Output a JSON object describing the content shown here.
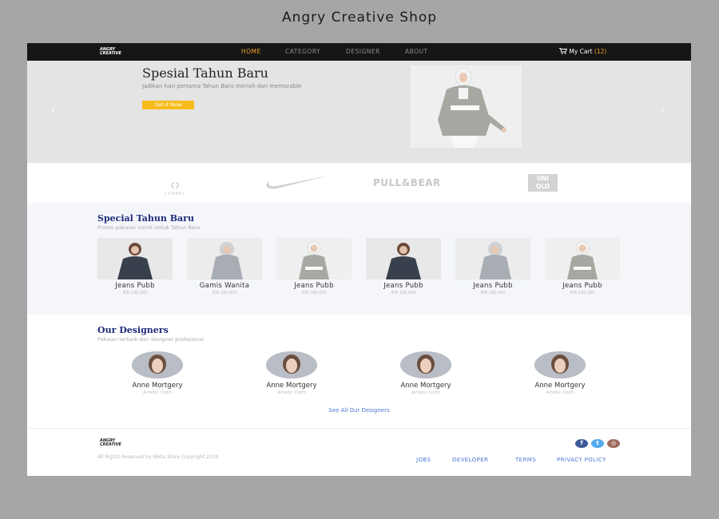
{
  "page_title": "Angry Creative Shop",
  "nav": {
    "logo_line1": "ANGRY",
    "logo_line2": "CREATIVE",
    "items": [
      "HOME",
      "CATEGORY",
      "DESIGNER",
      "ABOUT"
    ],
    "cart_label": "My Cart",
    "cart_count": "(12)"
  },
  "hero": {
    "title": "Spesial Tahun Baru",
    "subtitle": "Jadikan hari pertama Tahun Baru meriah dan memorable",
    "button": "Get It Now",
    "prev": "‹",
    "next": "›"
  },
  "brands": [
    "CHANEL",
    "PULL&BEAR",
    "UNI",
    "QLO"
  ],
  "specials": {
    "title": "Special Tahun Baru",
    "subtitle": "Promo pakaian cocok untuk Tahun Baru",
    "products": [
      {
        "name": "Jeans Pubb",
        "price": "IDR 190.000"
      },
      {
        "name": "Gamis Wanita",
        "price": "IDR 190.000"
      },
      {
        "name": "Jeans Pubb",
        "price": "IDR 190.000"
      },
      {
        "name": "Jeans Pubb",
        "price": "IDR 190.000"
      },
      {
        "name": "Jeans Pubb",
        "price": "IDR 190.000"
      },
      {
        "name": "Jeans Pubb",
        "price": "IDR 190.000"
      }
    ]
  },
  "designers": {
    "title": "Our Designers",
    "subtitle": "Pakaian terbaik dari designer profesional",
    "people": [
      {
        "name": "Anne Mortgery",
        "role": "Artistic Cloth"
      },
      {
        "name": "Anne Mortgery",
        "role": "Artistic Cloth"
      },
      {
        "name": "Anne Mortgery",
        "role": "Artistic Cloth"
      },
      {
        "name": "Anne Mortgery",
        "role": "Artistic Cloth"
      }
    ],
    "see_all": "See All Our Designers"
  },
  "footer": {
    "copyright": "All Rights Reserved by Mella Store Copyright 2019",
    "links": [
      "JOBS",
      "DEVELOPER",
      "TERMS",
      "PRIVACY POLICY"
    ],
    "social": [
      "facebook-icon",
      "twitter-icon",
      "instagram-icon"
    ],
    "social_glyphs": [
      "f",
      "t",
      "◎"
    ]
  },
  "colors": {
    "accent": "#f5a623",
    "button": "#f7bb1c",
    "heading": "#1f2a7a",
    "link": "#4a78d6",
    "facebook": "#3b5998",
    "twitter": "#55acee",
    "instagram": "#9e6b5d"
  }
}
